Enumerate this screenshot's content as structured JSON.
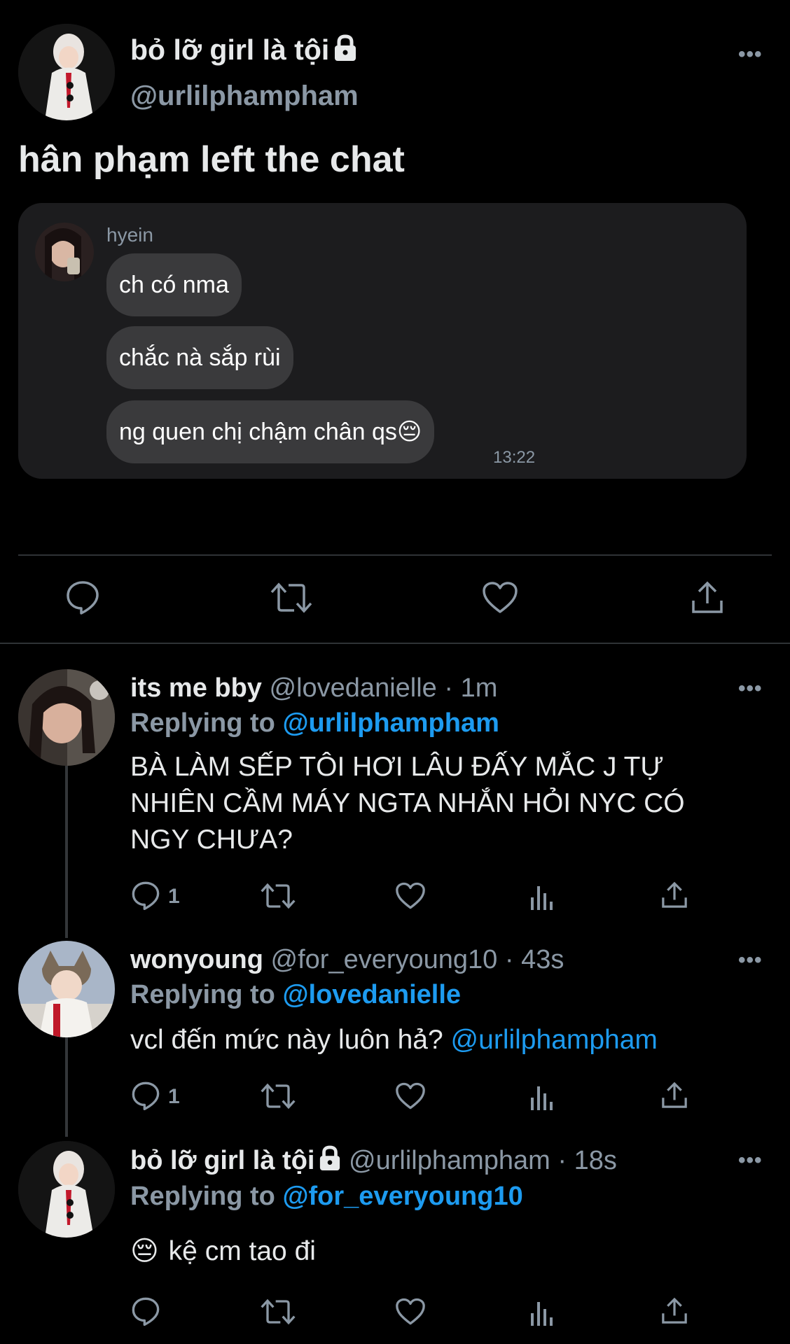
{
  "main_tweet": {
    "display_name": "bỏ lỡ girl là tội",
    "handle": "@urlilphampham",
    "text": "hân phạm left the chat",
    "embedded_chat": {
      "sender": "hyein",
      "messages": [
        "ch có nma",
        "chắc nà sắp rùi",
        "ng quen chị chậm chân qs😔"
      ],
      "time": "13:22"
    }
  },
  "more_glyph": "•••",
  "replies": [
    {
      "display_name": "its me bby",
      "handle": "@lovedanielle",
      "time": "· 1m",
      "replying_label": "Replying to",
      "replying_to": "@urlilphampham",
      "text": "BÀ LÀM SẾP TÔI HƠI LÂU ĐẤY MẮC J TỰ NHIÊN CẦM MÁY NGTA NHẮN HỎI NYC CÓ NGY CHƯA?",
      "reply_count": "1"
    },
    {
      "display_name": "wonyoung",
      "handle": "@for_everyoung10",
      "time": "· 43s",
      "replying_label": "Replying to",
      "replying_to": "@lovedanielle",
      "text": "vcl đến mức này luôn hả?",
      "mention": "@urlilphampham",
      "reply_count": "1"
    },
    {
      "display_name": "bỏ lỡ girl là tội",
      "handle": "@urlilphampham",
      "time": "· 18s",
      "replying_label": "Replying to",
      "replying_to": "@for_everyoung10",
      "emoji": "😔",
      "text": "kệ cm tao đi"
    }
  ],
  "icons": {
    "reply": "reply-icon",
    "retweet": "retweet-icon",
    "like": "heart-icon",
    "views": "views-icon",
    "share": "share-icon",
    "lock": "lock-icon",
    "more": "more-icon"
  },
  "colors": {
    "background": "#000000",
    "link": "#1d9bf0",
    "muted": "#8b98a5",
    "bubble": "#3a3a3c"
  }
}
